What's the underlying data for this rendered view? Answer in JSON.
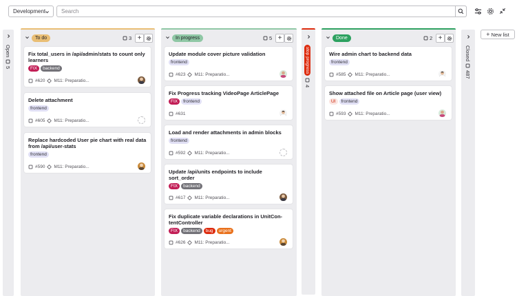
{
  "toolbar": {
    "board_name": "Development",
    "search_placeholder": "Search"
  },
  "collapsed_lists": [
    {
      "name": "Open",
      "count": "5"
    },
    {
      "name": "stop progress",
      "count": "4"
    },
    {
      "name": "Closed",
      "count": "487"
    }
  ],
  "lists": [
    {
      "label": "To do",
      "count": "3",
      "color": "#e9be74",
      "label_bg": "#e9be74",
      "cards": [
        {
          "title": "Fix total_users in /api/admin/stats to count only learners",
          "tags": [
            {
              "text": "FIX",
              "bg": "#c21e56",
              "fg": "#ffffff"
            },
            {
              "text": "backend",
              "bg": "#737278",
              "fg": "#ffffff"
            }
          ],
          "number": "#620",
          "milestone": "M11: Preparatio..."
        },
        {
          "title": "Delete attachment",
          "tags": [
            {
              "text": "frontend",
              "bg": "#e1e0f5",
              "fg": "#333238"
            }
          ],
          "number": "#605",
          "milestone": "M11: Preparatio..."
        },
        {
          "title": "Replace hardcoded User pie chart with real data from /api/user-stats",
          "tags": [
            {
              "text": "frontend",
              "bg": "#e1e0f5",
              "fg": "#333238"
            }
          ],
          "number": "#590",
          "milestone": "M11: Preparatio..."
        }
      ]
    },
    {
      "label": "In progress",
      "count": "5",
      "color": "#8fc7a5",
      "label_bg": "#8fc7a5",
      "cards": [
        {
          "title": "Update module cover picture validation",
          "tags": [
            {
              "text": "frontend",
              "bg": "#e1e0f5",
              "fg": "#333238"
            }
          ],
          "number": "#623",
          "milestone": "M11: Preparatio..."
        },
        {
          "title": "Fix Progress tracking VideoPage ArticlePage",
          "tags": [
            {
              "text": "FIX",
              "bg": "#c21e56",
              "fg": "#ffffff"
            },
            {
              "text": "frontend",
              "bg": "#e1e0f5",
              "fg": "#333238"
            }
          ],
          "number": "#631",
          "milestone": ""
        },
        {
          "title": "Load and render attachments in admin blocks",
          "tags": [
            {
              "text": "frontend",
              "bg": "#e1e0f5",
              "fg": "#333238"
            }
          ],
          "number": "#592",
          "milestone": "M11: Preparatio..."
        },
        {
          "title": "Update /api/units endpoints to include sort_order",
          "tags": [
            {
              "text": "FIX",
              "bg": "#c21e56",
              "fg": "#ffffff"
            },
            {
              "text": "backend",
              "bg": "#737278",
              "fg": "#ffffff"
            }
          ],
          "number": "#617",
          "milestone": "M11: Preparatio..."
        },
        {
          "title": "Fix duplicate variable declarations in UnitCon-tentController",
          "tags": [
            {
              "text": "FIX",
              "bg": "#c21e56",
              "fg": "#ffffff"
            },
            {
              "text": "backend",
              "bg": "#737278",
              "fg": "#ffffff"
            },
            {
              "text": "bug",
              "bg": "#dd2b0e",
              "fg": "#ffffff"
            },
            {
              "text": "urgent",
              "bg": "#e9711c",
              "fg": "#ffffff"
            }
          ],
          "number": "#626",
          "milestone": "M11: Preparatio..."
        }
      ]
    },
    {
      "label": "Done",
      "count": "2",
      "color": "#2da160",
      "label_bg": "#2da160",
      "cards": [
        {
          "title": "Wire admin chart to backend data",
          "tags": [
            {
              "text": "frontend",
              "bg": "#e1e0f5",
              "fg": "#333238"
            }
          ],
          "number": "#585",
          "milestone": "M11: Preparatio..."
        },
        {
          "title": "Show attached file on Article page (user view)",
          "tags": [
            {
              "text": "UI",
              "bg": "#fbe5e1",
              "fg": "#c91c00"
            },
            {
              "text": "frontend",
              "bg": "#e1e0f5",
              "fg": "#333238"
            }
          ],
          "number": "#593",
          "milestone": "M11: Preparatio..."
        }
      ]
    }
  ],
  "new_list_label": "New list"
}
